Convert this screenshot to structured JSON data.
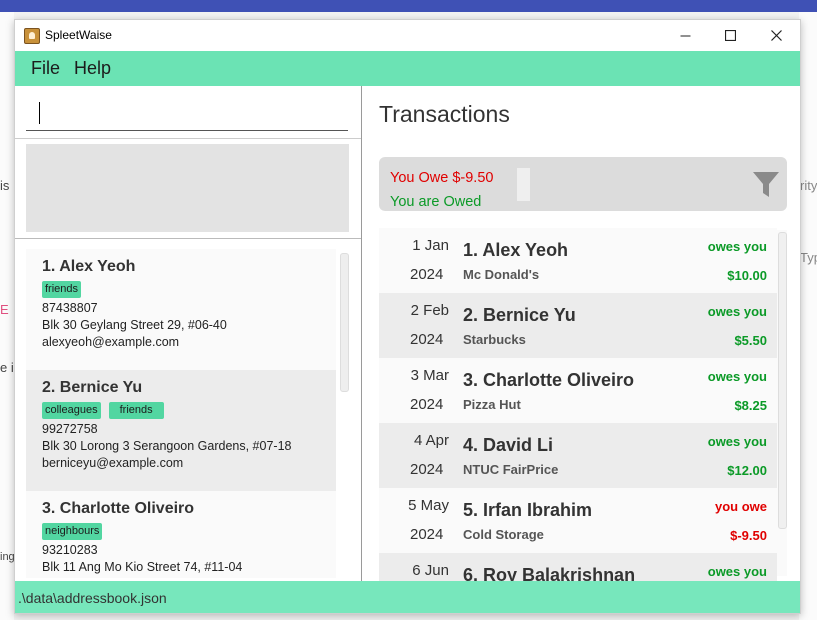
{
  "window": {
    "title": "SpleetWaise",
    "controls": {
      "minimize": "—",
      "maximize": "☐",
      "close": "✕"
    }
  },
  "menu": {
    "items": [
      "File",
      "Help"
    ]
  },
  "search": {
    "value": "",
    "placeholder": ""
  },
  "persons": [
    {
      "name": "1. Alex Yeoh",
      "tags": [
        "friends"
      ],
      "phone": "87438807",
      "address": "Blk 30 Geylang Street 29, #06-40",
      "email": "alexyeoh@example.com"
    },
    {
      "name": "2. Bernice Yu",
      "tags": [
        "colleagues",
        "friends"
      ],
      "phone": "99272758",
      "address": "Blk 30 Lorong 3 Serangoon Gardens, #07-18",
      "email": "berniceyu@example.com"
    },
    {
      "name": "3. Charlotte Oliveiro",
      "tags": [
        "neighbours"
      ],
      "phone": "93210283",
      "address": "Blk 11 Ang Mo Kio Street 74, #11-04",
      "email": ""
    }
  ],
  "transactions_panel": {
    "title": "Transactions",
    "summary": {
      "you_owe": "You Owe $-9.50",
      "you_are_owed": "You are Owed"
    },
    "filter_icon": "filter-icon"
  },
  "transactions": [
    {
      "day_month": "1 Jan",
      "year": "2024",
      "name": "1. Alex Yeoh",
      "description": "Mc Donald's",
      "status": "owes you",
      "amount": "$10.00",
      "direction": "in"
    },
    {
      "day_month": "2 Feb",
      "year": "2024",
      "name": "2. Bernice Yu",
      "description": "Starbucks",
      "status": "owes you",
      "amount": "$5.50",
      "direction": "in"
    },
    {
      "day_month": "3 Mar",
      "year": "2024",
      "name": "3. Charlotte Oliveiro",
      "description": "Pizza Hut",
      "status": "owes you",
      "amount": "$8.25",
      "direction": "in"
    },
    {
      "day_month": "4 Apr",
      "year": "2024",
      "name": "4. David Li",
      "description": "NTUC FairPrice",
      "status": "owes you",
      "amount": "$12.00",
      "direction": "in"
    },
    {
      "day_month": "5 May",
      "year": "2024",
      "name": "5. Irfan Ibrahim",
      "description": "Cold Storage",
      "status": "you owe",
      "amount": "$-9.50",
      "direction": "out"
    },
    {
      "day_month": "6 Jun",
      "year": "",
      "name": "6. Roy Balakrishnan",
      "description": "",
      "status": "owes you",
      "amount": "",
      "direction": "in"
    }
  ],
  "statusbar": {
    "path": ".\\data\\addressbook.json"
  },
  "background_fragments": {
    "left": [
      "is",
      "E",
      "e i",
      "ing"
    ],
    "right": [
      "rity",
      "Typ"
    ]
  },
  "colors": {
    "accent": "#6be3b4",
    "tag": "#52d6a1",
    "owes_you": "#0b9a27",
    "you_owe": "#e00000",
    "top_strip": "#3f51b5"
  }
}
